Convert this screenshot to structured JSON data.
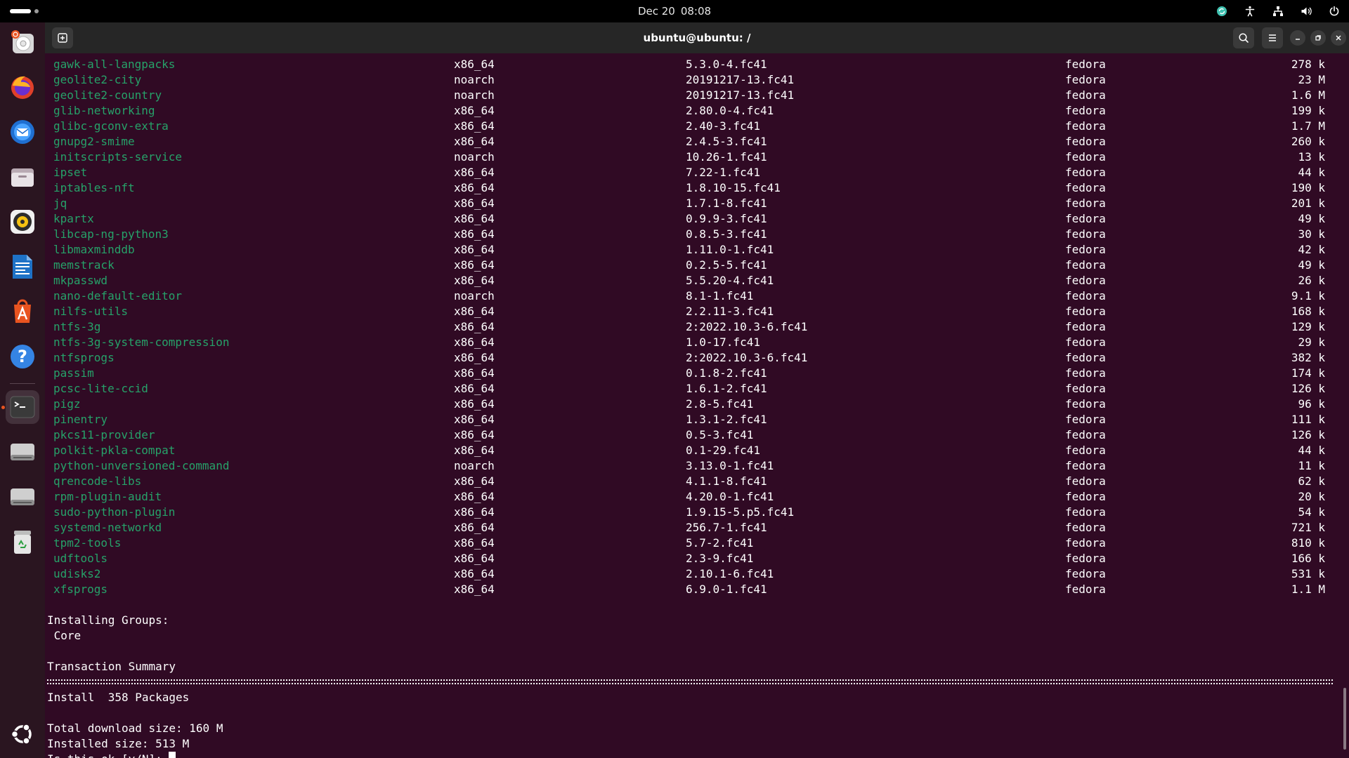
{
  "topbar": {
    "date": "Dec 20",
    "time": "08:08"
  },
  "window": {
    "title": "ubuntu@ubuntu: /"
  },
  "terminal": {
    "packages": [
      {
        "name": "gawk-all-langpacks",
        "arch": "x86_64",
        "version": "5.3.0-4.fc41",
        "repo": "fedora",
        "size": "278 k"
      },
      {
        "name": "geolite2-city",
        "arch": "noarch",
        "version": "20191217-13.fc41",
        "repo": "fedora",
        "size": "23 M"
      },
      {
        "name": "geolite2-country",
        "arch": "noarch",
        "version": "20191217-13.fc41",
        "repo": "fedora",
        "size": "1.6 M"
      },
      {
        "name": "glib-networking",
        "arch": "x86_64",
        "version": "2.80.0-4.fc41",
        "repo": "fedora",
        "size": "199 k"
      },
      {
        "name": "glibc-gconv-extra",
        "arch": "x86_64",
        "version": "2.40-3.fc41",
        "repo": "fedora",
        "size": "1.7 M"
      },
      {
        "name": "gnupg2-smime",
        "arch": "x86_64",
        "version": "2.4.5-3.fc41",
        "repo": "fedora",
        "size": "260 k"
      },
      {
        "name": "initscripts-service",
        "arch": "noarch",
        "version": "10.26-1.fc41",
        "repo": "fedora",
        "size": "13 k"
      },
      {
        "name": "ipset",
        "arch": "x86_64",
        "version": "7.22-1.fc41",
        "repo": "fedora",
        "size": "44 k"
      },
      {
        "name": "iptables-nft",
        "arch": "x86_64",
        "version": "1.8.10-15.fc41",
        "repo": "fedora",
        "size": "190 k"
      },
      {
        "name": "jq",
        "arch": "x86_64",
        "version": "1.7.1-8.fc41",
        "repo": "fedora",
        "size": "201 k"
      },
      {
        "name": "kpartx",
        "arch": "x86_64",
        "version": "0.9.9-3.fc41",
        "repo": "fedora",
        "size": "49 k"
      },
      {
        "name": "libcap-ng-python3",
        "arch": "x86_64",
        "version": "0.8.5-3.fc41",
        "repo": "fedora",
        "size": "30 k"
      },
      {
        "name": "libmaxminddb",
        "arch": "x86_64",
        "version": "1.11.0-1.fc41",
        "repo": "fedora",
        "size": "42 k"
      },
      {
        "name": "memstrack",
        "arch": "x86_64",
        "version": "0.2.5-5.fc41",
        "repo": "fedora",
        "size": "49 k"
      },
      {
        "name": "mkpasswd",
        "arch": "x86_64",
        "version": "5.5.20-4.fc41",
        "repo": "fedora",
        "size": "26 k"
      },
      {
        "name": "nano-default-editor",
        "arch": "noarch",
        "version": "8.1-1.fc41",
        "repo": "fedora",
        "size": "9.1 k"
      },
      {
        "name": "nilfs-utils",
        "arch": "x86_64",
        "version": "2.2.11-3.fc41",
        "repo": "fedora",
        "size": "168 k"
      },
      {
        "name": "ntfs-3g",
        "arch": "x86_64",
        "version": "2:2022.10.3-6.fc41",
        "repo": "fedora",
        "size": "129 k"
      },
      {
        "name": "ntfs-3g-system-compression",
        "arch": "x86_64",
        "version": "1.0-17.fc41",
        "repo": "fedora",
        "size": "29 k"
      },
      {
        "name": "ntfsprogs",
        "arch": "x86_64",
        "version": "2:2022.10.3-6.fc41",
        "repo": "fedora",
        "size": "382 k"
      },
      {
        "name": "passim",
        "arch": "x86_64",
        "version": "0.1.8-2.fc41",
        "repo": "fedora",
        "size": "174 k"
      },
      {
        "name": "pcsc-lite-ccid",
        "arch": "x86_64",
        "version": "1.6.1-2.fc41",
        "repo": "fedora",
        "size": "126 k"
      },
      {
        "name": "pigz",
        "arch": "x86_64",
        "version": "2.8-5.fc41",
        "repo": "fedora",
        "size": "96 k"
      },
      {
        "name": "pinentry",
        "arch": "x86_64",
        "version": "1.3.1-2.fc41",
        "repo": "fedora",
        "size": "111 k"
      },
      {
        "name": "pkcs11-provider",
        "arch": "x86_64",
        "version": "0.5-3.fc41",
        "repo": "fedora",
        "size": "126 k"
      },
      {
        "name": "polkit-pkla-compat",
        "arch": "x86_64",
        "version": "0.1-29.fc41",
        "repo": "fedora",
        "size": "44 k"
      },
      {
        "name": "python-unversioned-command",
        "arch": "noarch",
        "version": "3.13.0-1.fc41",
        "repo": "fedora",
        "size": "11 k"
      },
      {
        "name": "qrencode-libs",
        "arch": "x86_64",
        "version": "4.1.1-8.fc41",
        "repo": "fedora",
        "size": "62 k"
      },
      {
        "name": "rpm-plugin-audit",
        "arch": "x86_64",
        "version": "4.20.0-1.fc41",
        "repo": "fedora",
        "size": "20 k"
      },
      {
        "name": "sudo-python-plugin",
        "arch": "x86_64",
        "version": "1.9.15-5.p5.fc41",
        "repo": "fedora",
        "size": "54 k"
      },
      {
        "name": "systemd-networkd",
        "arch": "x86_64",
        "version": "256.7-1.fc41",
        "repo": "fedora",
        "size": "721 k"
      },
      {
        "name": "tpm2-tools",
        "arch": "x86_64",
        "version": "5.7-2.fc41",
        "repo": "fedora",
        "size": "810 k"
      },
      {
        "name": "udftools",
        "arch": "x86_64",
        "version": "2.3-9.fc41",
        "repo": "fedora",
        "size": "166 k"
      },
      {
        "name": "udisks2",
        "arch": "x86_64",
        "version": "2.10.1-6.fc41",
        "repo": "fedora",
        "size": "531 k"
      },
      {
        "name": "xfsprogs",
        "arch": "x86_64",
        "version": "6.9.0-1.fc41",
        "repo": "fedora",
        "size": "1.1 M"
      }
    ],
    "groups_heading": "Installing Groups:",
    "group_core": " Core",
    "summary_heading": "Transaction Summary",
    "install_line": "Install  358 Packages",
    "download_size": "Total download size: 160 M",
    "installed_size": "Installed size: 513 M",
    "prompt": "Is this ok [y/N]: "
  },
  "dock": {
    "apps": [
      "Ubuntu Installer",
      "Firefox",
      "Thunderbird",
      "Files",
      "Rhythmbox",
      "LibreOffice Writer",
      "App Center",
      "Help",
      "Terminal",
      "Drive",
      "Drive",
      "Trash",
      "Show Apps"
    ]
  },
  "colors": {
    "terminal_bg": "#300a24",
    "package_name": "#26a269",
    "headerbar": "#262626",
    "dock_bg": "#2a1520",
    "accent": "#e95420"
  }
}
